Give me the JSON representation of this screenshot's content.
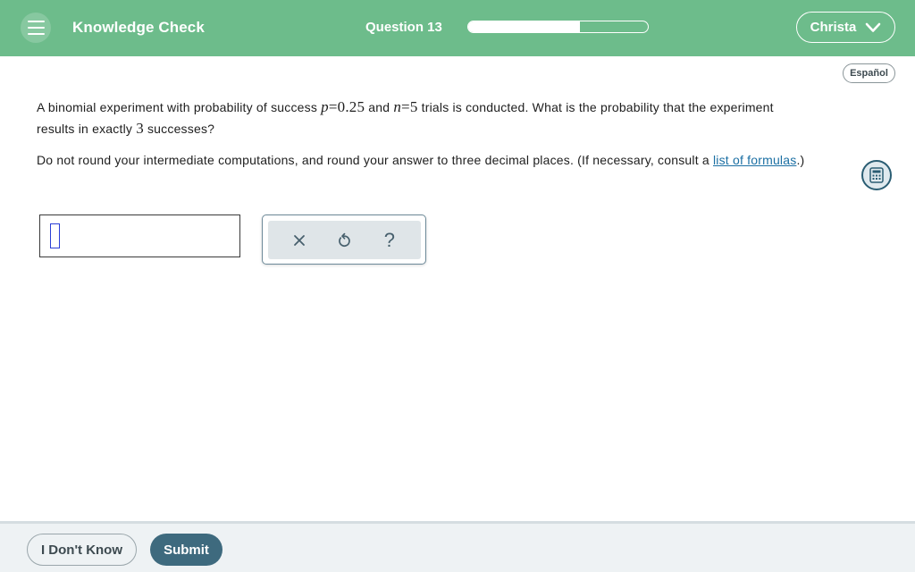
{
  "header": {
    "title": "Knowledge Check",
    "question_label": "Question 13",
    "progress": 0.62,
    "user_name": "Christa"
  },
  "language_button": "Español",
  "question": {
    "part1": "A binomial experiment with probability of success ",
    "p_var": "p",
    "p_value": "=0.25",
    "part2": " and ",
    "n_var": "n",
    "n_value": "=5",
    "part3": " trials is conducted. What is the probability that the experiment results in exactly ",
    "k_value": "3",
    "part4": " successes?"
  },
  "instruction": {
    "text": "Do not round your intermediate computations, and round your answer to three decimal places. (If necessary, consult a ",
    "link_text": "list of formulas",
    "suffix": ".)"
  },
  "answer": {
    "value": ""
  },
  "tools": {
    "clear_icon": "close-icon",
    "undo_icon": "undo-icon",
    "help_glyph": "?"
  },
  "footer": {
    "dont_know_label": "I Don't Know",
    "submit_label": "Submit"
  },
  "colors": {
    "header_bg": "#6dbc8b",
    "submit_bg": "#3e6a7e",
    "link": "#1b6fa3",
    "caret": "#2b3fd6"
  }
}
